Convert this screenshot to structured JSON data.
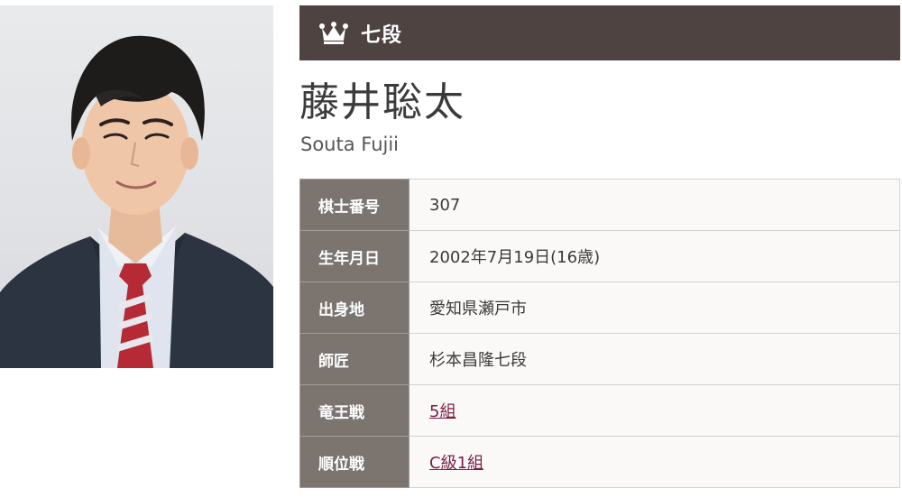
{
  "profile": {
    "rank": "七段",
    "name_ja": "藤井聡太",
    "name_en": "Souta Fujii",
    "photo_icon": "portrait-photo"
  },
  "colors": {
    "header_bg": "#4e4340",
    "label_bg": "#7b746f",
    "link": "#7a1d46"
  },
  "rows": [
    {
      "label": "棋士番号",
      "value": "307",
      "is_link": false
    },
    {
      "label": "生年月日",
      "value": "2002年7月19日(16歳)",
      "is_link": false
    },
    {
      "label": "出身地",
      "value": "愛知県瀬戸市",
      "is_link": false
    },
    {
      "label": "師匠",
      "value": "杉本昌隆七段",
      "is_link": false
    },
    {
      "label": "竜王戦",
      "value": "5組",
      "is_link": true
    },
    {
      "label": "順位戦",
      "value": "C級1組",
      "is_link": true
    }
  ]
}
